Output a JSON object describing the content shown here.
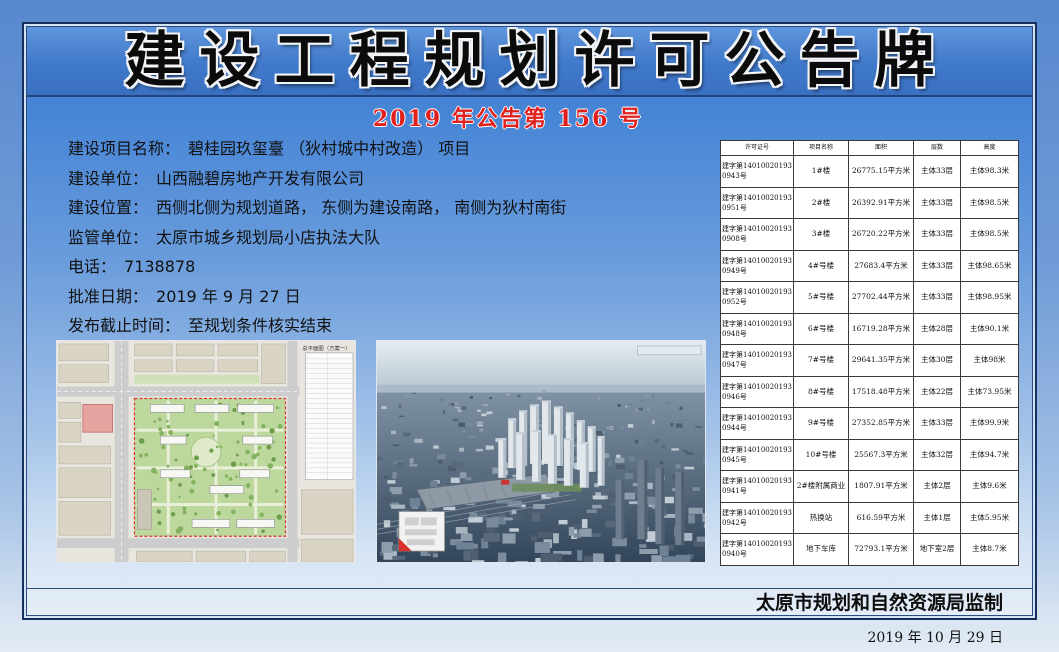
{
  "board": {
    "title": "建设工程规划许可公告牌",
    "notice_number": "2019 年公告第 156 号",
    "fields": [
      {
        "label": "建设项目名称：",
        "value": "碧桂园玖玺臺 （狄村城中村改造） 项目"
      },
      {
        "label": "建设单位：",
        "value": "山西融碧房地产开发有限公司"
      },
      {
        "label": "建设位置：",
        "value": "西侧北侧为规划道路， 东侧为建设南路， 南侧为狄村南街"
      },
      {
        "label": "监管单位：",
        "value": "太原市城乡规划局小店执法大队"
      },
      {
        "label": "电话：",
        "value": "7138878"
      },
      {
        "label": "批准日期：",
        "value": "2019 年 9 月 27 日"
      },
      {
        "label": "发布截止时间：",
        "value": "至规划条件核实结束"
      }
    ],
    "permit_table": {
      "headers": [
        "许可证号",
        "项目名称",
        "面积",
        "层数",
        "高度"
      ],
      "rows": [
        [
          "建字第140100201930943号",
          "1#楼",
          "26775.15平方米",
          "主体33层",
          "主体98.3米"
        ],
        [
          "建字第140100201930951号",
          "2#楼",
          "26392.91平方米",
          "主体33层",
          "主体98.5米"
        ],
        [
          "建字第140100201930908号",
          "3#楼",
          "26720.22平方米",
          "主体33层",
          "主体98.5米"
        ],
        [
          "建字第140100201930949号",
          "4#号楼",
          "27683.4平方米",
          "主体33层",
          "主体98.65米"
        ],
        [
          "建字第140100201930952号",
          "5#号楼",
          "27702.44平方米",
          "主体33层",
          "主体98.95米"
        ],
        [
          "建字第140100201930948号",
          "6#号楼",
          "16719.28平方米",
          "主体28层",
          "主体90.1米"
        ],
        [
          "建字第140100201930947号",
          "7#号楼",
          "29641.35平方米",
          "主体30层",
          "主体98米"
        ],
        [
          "建字第140100201930946号",
          "8#号楼",
          "17518.48平方米",
          "主体22层",
          "主体73.95米"
        ],
        [
          "建字第140100201930944号",
          "9#号楼",
          "27352.85平方米",
          "主体33层",
          "主体99.9米"
        ],
        [
          "建字第140100201930945号",
          "10#号楼",
          "25567.3平方米",
          "主体32层",
          "主体94.7米"
        ],
        [
          "建字第140100201930941号",
          "2#楼附属商业",
          "1807.91平方米",
          "主体2层",
          "主体9.6米"
        ],
        [
          "建字第140100201930942号",
          "热换站",
          "616.59平方米",
          "主体1层",
          "主体5.95米"
        ],
        [
          "建字第140100201930940号",
          "地下车库",
          "72793.1平方米",
          "地下室2层",
          "主体8.7米"
        ]
      ]
    },
    "site_plan_caption": "总平面图（方案一）",
    "footer_issuer": "太原市规划和自然资源局监制",
    "issue_date": "2019 年 10 月 29 日"
  },
  "colors": {
    "board_top": "#3c74c8",
    "board_bottom": "#e6eef8",
    "notice_number_red": "#e0201c",
    "title_text": "#0b0b0b",
    "table_grid": "#3a3a3a",
    "table_text": "#111111"
  }
}
